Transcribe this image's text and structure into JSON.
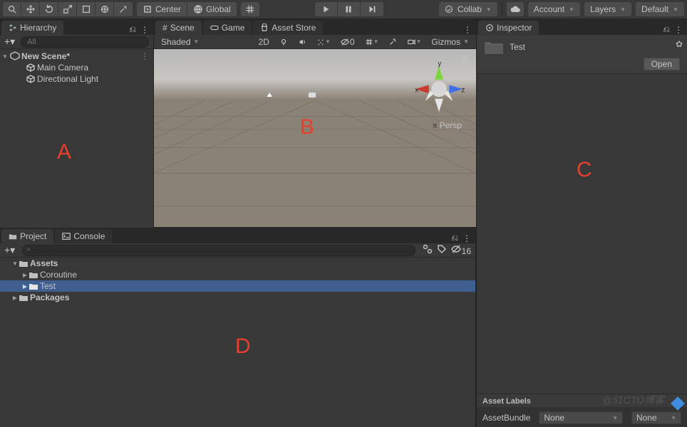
{
  "top_toolbar": {
    "pivot_label": "Center",
    "space_label": "Global",
    "collab_label": "Collab",
    "account_label": "Account",
    "layers_label": "Layers",
    "layout_label": "Default"
  },
  "hierarchy": {
    "tab_label": "Hierarchy",
    "search_placeholder": "All",
    "scene_name": "New Scene*",
    "items": [
      {
        "label": "Main Camera"
      },
      {
        "label": "Directional Light"
      }
    ]
  },
  "scene_tabs": {
    "scene": "Scene",
    "game": "Game",
    "asset_store": "Asset Store"
  },
  "scene_toolbar": {
    "shading_mode": "Shaded",
    "mode_2d": "2D",
    "hidden_count": "0",
    "gizmos_label": "Gizmos"
  },
  "scene_view": {
    "projection_label": "Persp",
    "axis_x": "x",
    "axis_y": "y",
    "axis_z": "z"
  },
  "project": {
    "tab_project": "Project",
    "tab_console": "Console",
    "search_placeholder": "",
    "visible_count": "16",
    "tree": {
      "assets_label": "Assets",
      "folders": [
        {
          "label": "Coroutine",
          "selected": false
        },
        {
          "label": "Test",
          "selected": true
        }
      ],
      "packages_label": "Packages"
    }
  },
  "inspector": {
    "tab_label": "Inspector",
    "asset_name": "Test",
    "open_button": "Open",
    "asset_labels_title": "Asset Labels",
    "asset_bundle_label": "AssetBundle",
    "asset_bundle_value": "None",
    "asset_bundle_variant": "None"
  },
  "annotations": {
    "a": "A",
    "b": "B",
    "c": "C",
    "d": "D"
  },
  "watermark": "@51CTO博客"
}
